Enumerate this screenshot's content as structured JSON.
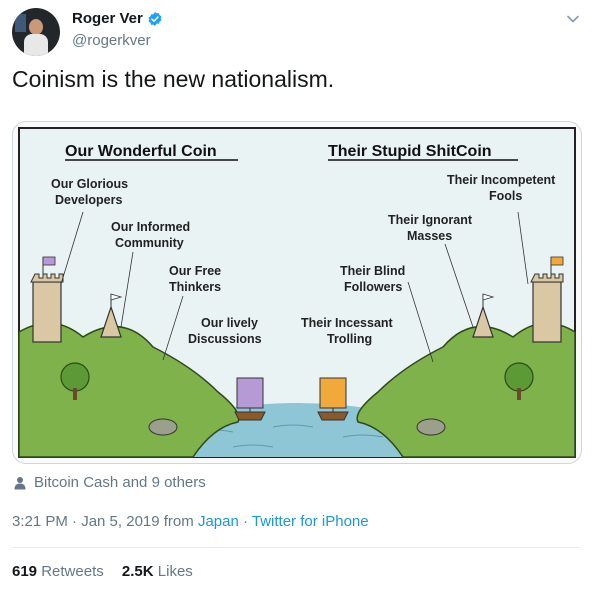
{
  "author": {
    "name": "Roger Ver",
    "handle": "@rogerkver"
  },
  "tweet": {
    "text": "Coinism is the new nationalism."
  },
  "cartoon": {
    "left_title": "Our Wonderful Coin",
    "right_title": "Their Stupid ShitCoin",
    "left_labels": [
      [
        "Our Glorious",
        "Developers"
      ],
      [
        "Our Informed",
        "Community"
      ],
      [
        "Our Free",
        "Thinkers"
      ],
      [
        "Our lively",
        "Discussions"
      ]
    ],
    "right_labels": [
      [
        "Their Incompetent",
        "Fools"
      ],
      [
        "Their Ignorant",
        "Masses"
      ],
      [
        "Their Blind",
        "Followers"
      ],
      [
        "Their Incessant",
        "Trolling"
      ]
    ],
    "colors": {
      "grass": "#7fb24a",
      "water": "#8fc6d6",
      "sky": "#e9f3f4",
      "left_sail": "#b69ad6",
      "right_sail": "#f2a93b"
    }
  },
  "tagged": "Bitcoin Cash and 9 others",
  "meta": {
    "time": "3:21 PM · Jan 5, 2019 from ",
    "location": "Japan",
    "sep": " · ",
    "source": "Twitter for iPhone"
  },
  "stats": {
    "retweets_count": "619",
    "retweets_label": "Retweets",
    "likes_count": "2.5K",
    "likes_label": "Likes"
  },
  "colors": {
    "link": "#1b95e0",
    "muted": "#657786",
    "verified": "#1da1f2"
  }
}
